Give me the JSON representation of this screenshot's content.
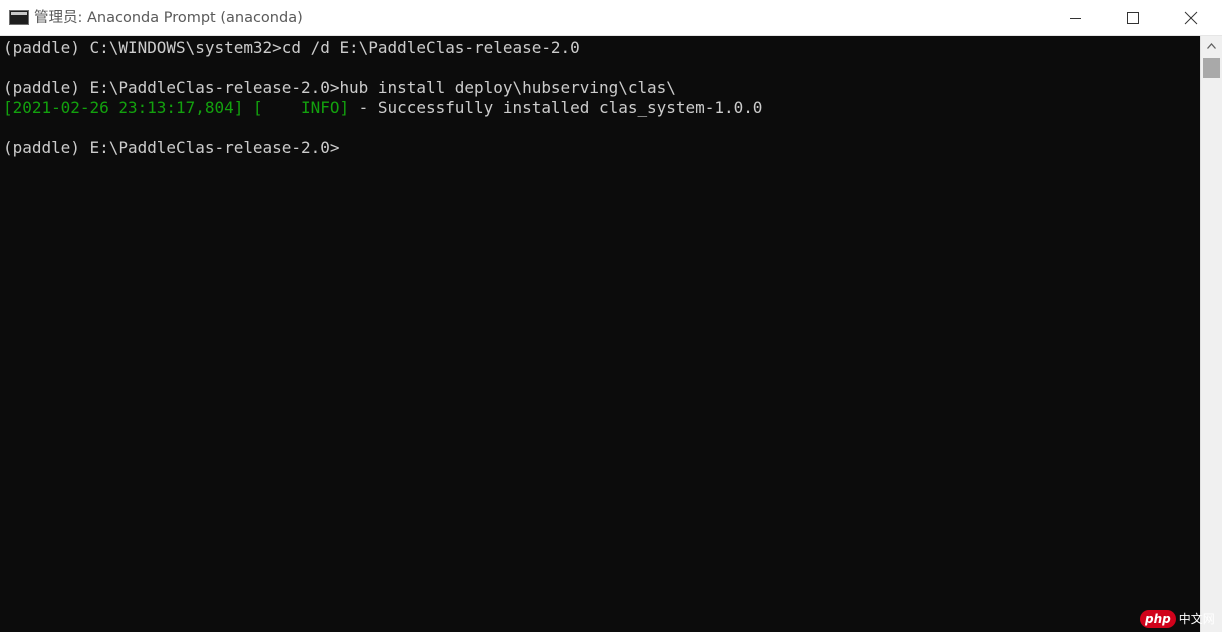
{
  "window": {
    "title": "管理员: Anaconda Prompt (anaconda)",
    "icon": "terminal-icon"
  },
  "controls": {
    "minimize_icon": "minimize-icon",
    "maximize_icon": "maximize-icon",
    "close_icon": "close-icon"
  },
  "console": {
    "line1": "(paddle) C:\\WINDOWS\\system32>cd /d E:\\PaddleClas-release-2.0",
    "line2": "(paddle) E:\\PaddleClas-release-2.0>hub install deploy\\hubserving\\clas\\",
    "log_time": "[2021-02-26 23:13:17,804] [    INFO]",
    "log_message": " - Successfully installed clas_system-1.0.0",
    "line4": "(paddle) E:\\PaddleClas-release-2.0>"
  },
  "colors": {
    "background": "#0c0c0c",
    "text": "#cccccc",
    "log_green": "#13a10e"
  },
  "watermark": {
    "badge": "php",
    "text": "中文网"
  }
}
